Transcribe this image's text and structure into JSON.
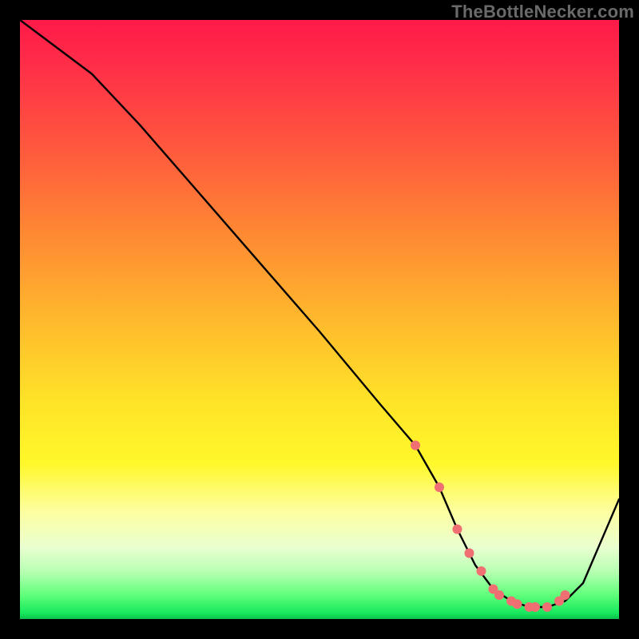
{
  "watermark": "TheBottleNecker.com",
  "chart_data": {
    "type": "line",
    "title": "",
    "xlabel": "",
    "ylabel": "",
    "xlim": [
      0,
      100
    ],
    "ylim": [
      0,
      100
    ],
    "grid": false,
    "series": [
      {
        "name": "curve",
        "x": [
          0,
          4,
          8,
          12,
          20,
          30,
          40,
          50,
          60,
          66,
          70,
          73,
          76,
          79,
          82,
          85,
          88,
          91,
          94,
          100
        ],
        "y": [
          100,
          97,
          94,
          91,
          82.5,
          71,
          59.5,
          48,
          36,
          29,
          22,
          15,
          9,
          5,
          3,
          2,
          2,
          3,
          6,
          20
        ]
      }
    ],
    "markers": {
      "name": "dots",
      "color": "#ef6f72",
      "x": [
        66,
        70,
        73,
        75,
        77,
        79,
        80,
        82,
        83,
        85,
        86,
        88,
        90,
        91
      ],
      "y": [
        29,
        22,
        15,
        11,
        8,
        5,
        4,
        3,
        2.5,
        2,
        2,
        2,
        3,
        4
      ]
    }
  }
}
